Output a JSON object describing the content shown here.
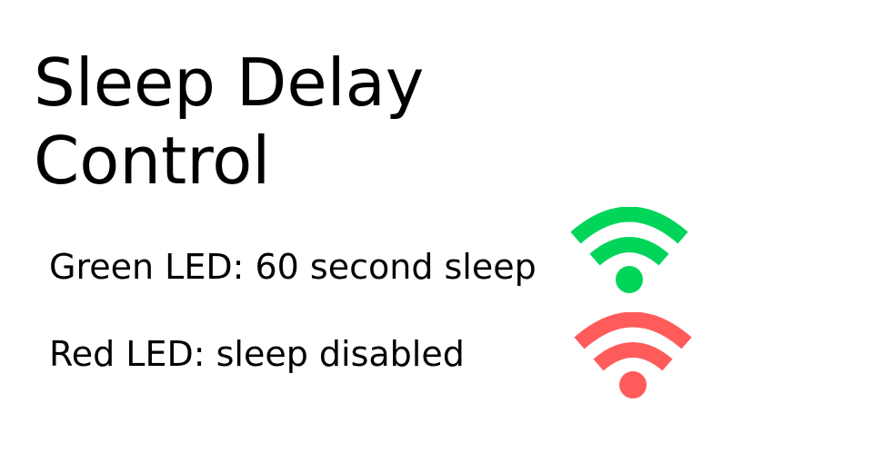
{
  "title": "Sleep Delay Control",
  "items": [
    {
      "label": "Green LED: 60 second sleep",
      "icon": "wifi-icon",
      "color": "#00d55a"
    },
    {
      "label": "Red LED: sleep disabled",
      "icon": "wifi-icon",
      "color": "#ff5b5b"
    }
  ]
}
